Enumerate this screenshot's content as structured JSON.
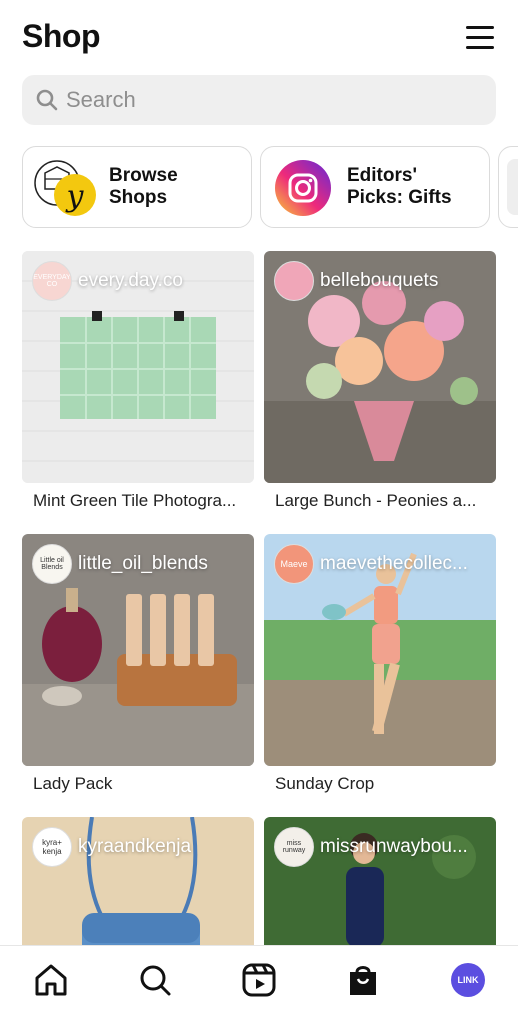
{
  "header": {
    "title": "Shop"
  },
  "search": {
    "placeholder": "Search"
  },
  "chips": [
    {
      "label": "Browse\nShops",
      "icon": "browse-shops-icon"
    },
    {
      "label": "Editors'\nPicks: Gifts",
      "icon": "instagram-icon"
    }
  ],
  "products": [
    {
      "handle": "every.day.co",
      "caption": "Mint Green Tile Photogra...",
      "avatar_text": "EVERYDAY CO"
    },
    {
      "handle": "bellebouquets",
      "caption": "Large Bunch - Peonies a...",
      "avatar_text": ""
    },
    {
      "handle": "little_oil_blends",
      "caption": "Lady Pack",
      "avatar_text": "Little oil Blends"
    },
    {
      "handle": "maevethecollec...",
      "caption": "Sunday Crop",
      "avatar_text": "Maeve"
    },
    {
      "handle": "kyraandkenja",
      "caption": "",
      "avatar_text": "kyra+ kenja"
    },
    {
      "handle": "missrunwaybou...",
      "caption": "",
      "avatar_text": "miss runway"
    }
  ],
  "bottom_nav": {
    "items": [
      "home-icon",
      "search-icon",
      "reels-icon",
      "shop-icon",
      "profile-avatar"
    ],
    "profile_label": "LINK"
  },
  "colors": {
    "accent": "#5b4ee0",
    "text": "#111111",
    "muted": "#8e8e8e"
  }
}
